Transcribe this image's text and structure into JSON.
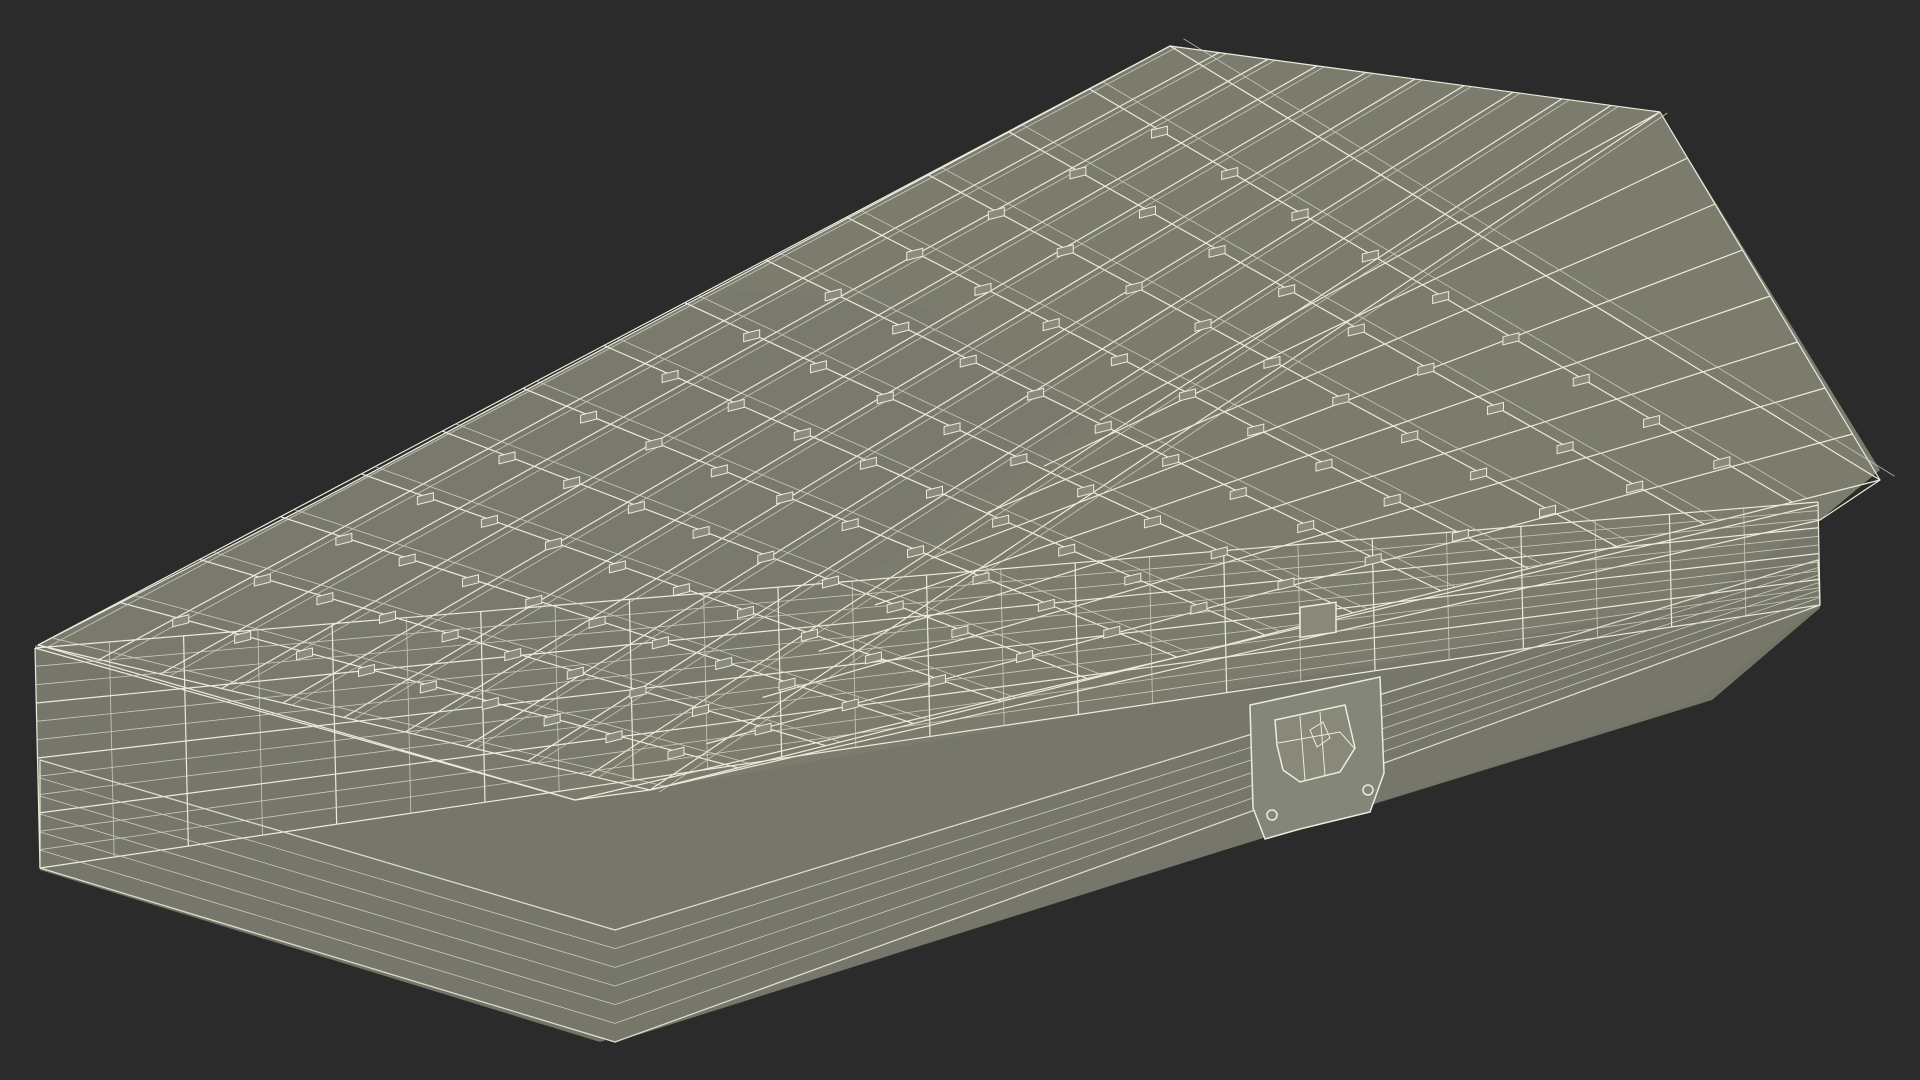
{
  "scene": {
    "subject": "wireframe-case-render",
    "colors": {
      "background": "#2b2b2b",
      "surface_top": "#7a7b6d",
      "surface_side": "#737466",
      "surface_dark": "#5f6055",
      "wire": "#ecebdc",
      "wire_faint": "#d9d8c8",
      "latch": "#85867a"
    }
  }
}
